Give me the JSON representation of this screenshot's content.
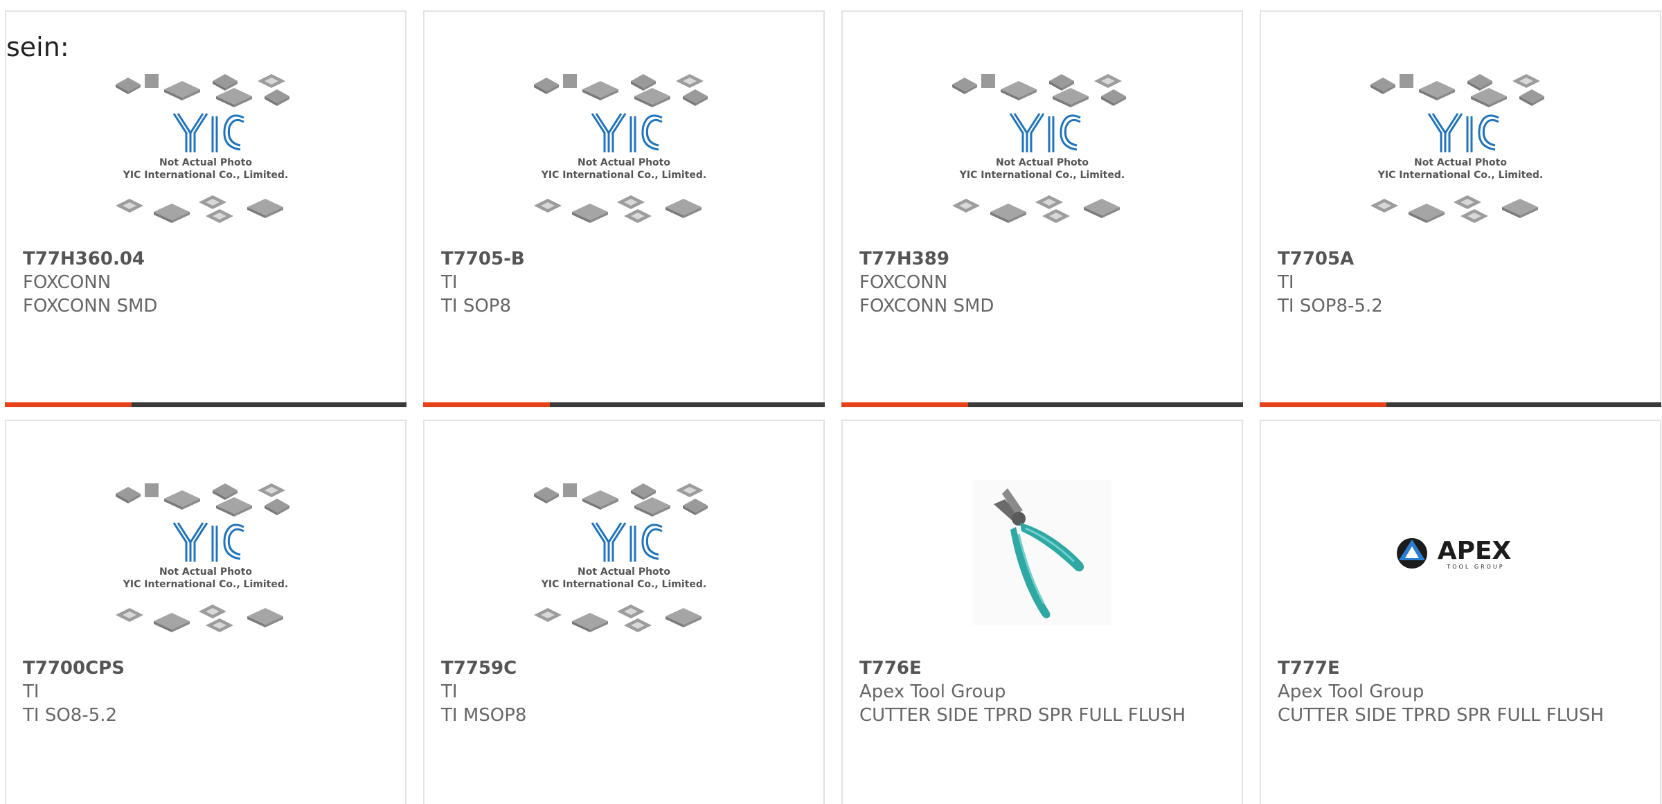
{
  "lead_text": "sein:",
  "placeholder_image": {
    "caption_line1": "Not Actual Photo",
    "caption_line2": "YIC International Co., Limited.",
    "logo_text": "YIC"
  },
  "apex_logo": {
    "word": "APEX",
    "sub": "TOOL GROUP"
  },
  "colors": {
    "accent": "#e8411a",
    "bar": "#3a3a3a",
    "yic_blue": "#1e73be",
    "plier_teal": "#2fa8a4"
  },
  "products": [
    {
      "part": "T77H360.04",
      "manufacturer": "FOXCONN",
      "description": "FOXCONN SMD",
      "image": "yic-placeholder"
    },
    {
      "part": "T7705-B",
      "manufacturer": "TI",
      "description": "TI SOP8",
      "image": "yic-placeholder"
    },
    {
      "part": "T77H389",
      "manufacturer": "FOXCONN",
      "description": "FOXCONN SMD",
      "image": "yic-placeholder"
    },
    {
      "part": "T7705A",
      "manufacturer": "TI",
      "description": "TI SOP8-5.2",
      "image": "yic-placeholder"
    },
    {
      "part": "T7700CPS",
      "manufacturer": "TI",
      "description": "TI SO8-5.2",
      "image": "yic-placeholder"
    },
    {
      "part": "T7759C",
      "manufacturer": "TI",
      "description": "TI MSOP8",
      "image": "yic-placeholder"
    },
    {
      "part": "T776E",
      "manufacturer": "Apex Tool Group",
      "description": "CUTTER SIDE TPRD SPR FULL FLUSH",
      "image": "plier-photo"
    },
    {
      "part": "T777E",
      "manufacturer": "Apex Tool Group",
      "description": "CUTTER SIDE TPRD SPR FULL FLUSH",
      "image": "apex-logo"
    }
  ]
}
